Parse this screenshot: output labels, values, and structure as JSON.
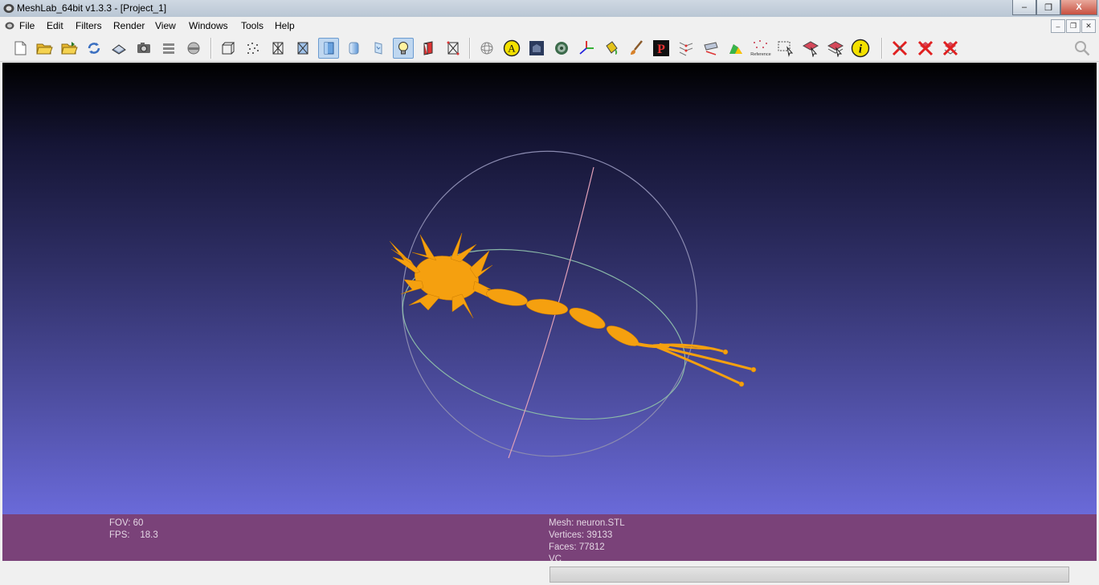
{
  "window": {
    "title": "MeshLab_64bit v1.3.3 - [Project_1]",
    "controls": {
      "minimize": "–",
      "maximize": "❐",
      "close": "X"
    }
  },
  "menubar": {
    "items": [
      "File",
      "Edit",
      "Filters",
      "Render",
      "View",
      "Windows",
      "Tools",
      "Help"
    ],
    "mdi_controls": {
      "minimize": "–",
      "restore": "❐",
      "close": "✕"
    }
  },
  "toolbar": {
    "buttons": [
      {
        "name": "new-project-icon"
      },
      {
        "name": "open-project-icon"
      },
      {
        "name": "import-mesh-icon"
      },
      {
        "name": "reload-icon"
      },
      {
        "name": "export-mesh-icon"
      },
      {
        "name": "snapshot-icon"
      },
      {
        "name": "layers-icon"
      },
      {
        "name": "raster-icon"
      },
      {
        "name": "bounding-box-icon"
      },
      {
        "name": "points-icon"
      },
      {
        "name": "wireframe-icon"
      },
      {
        "name": "hidden-lines-icon"
      },
      {
        "name": "flat-shading-icon",
        "active": true
      },
      {
        "name": "smooth-shading-icon"
      },
      {
        "name": "texture-icon"
      },
      {
        "name": "light-icon",
        "active": true
      },
      {
        "name": "back-face-icon"
      },
      {
        "name": "selected-faces-icon"
      },
      {
        "name": "trackball-icon"
      },
      {
        "name": "annotation-icon",
        "text": "A"
      },
      {
        "name": "raster-image-icon"
      },
      {
        "name": "ambient-occlusion-icon"
      },
      {
        "name": "axis-icon"
      },
      {
        "name": "paint-bucket-icon"
      },
      {
        "name": "brush-icon"
      },
      {
        "name": "pick-points-icon",
        "text": "P"
      },
      {
        "name": "align-icon"
      },
      {
        "name": "measure-icon"
      },
      {
        "name": "color-icon"
      },
      {
        "name": "reference-icon",
        "text": "Reference"
      },
      {
        "name": "select-vertices-icon"
      },
      {
        "name": "select-faces-icon"
      },
      {
        "name": "select-connected-icon"
      },
      {
        "name": "info-icon",
        "text": "i"
      },
      {
        "name": "delete-selection-icon"
      },
      {
        "name": "delete-faces-icon"
      },
      {
        "name": "delete-vertices-icon"
      },
      {
        "name": "search-icon"
      }
    ]
  },
  "info_left": {
    "fov_label": "FOV: 60",
    "fps_label": "FPS:    18.3"
  },
  "info_right": {
    "mesh": "Mesh: neuron.STL",
    "vertices": "Vertices: 39133",
    "faces": "Faces: 77812",
    "vc": "VC"
  },
  "colors": {
    "mesh": "#f5a00f",
    "infobar": "#7a4279",
    "viewport_top": "#000000",
    "viewport_bottom": "#6a6ad9"
  }
}
